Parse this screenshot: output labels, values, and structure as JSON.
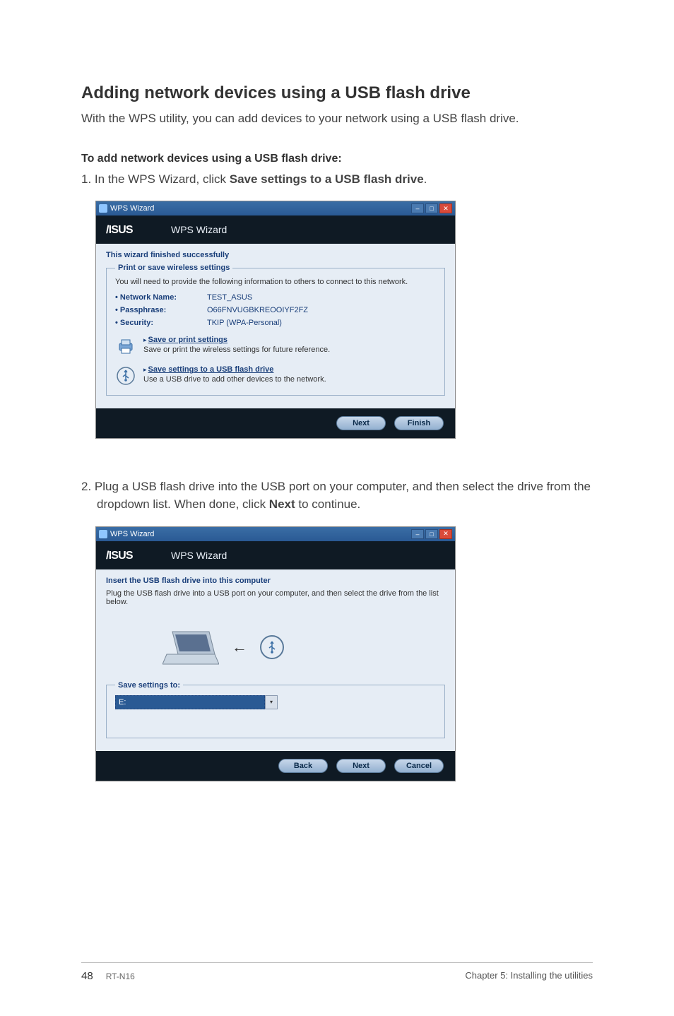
{
  "page": {
    "title": "Adding network devices using a USB flash drive",
    "intro": "With the WPS utility, you can add devices to your network using a USB flash drive.",
    "subhead": "To add network devices using a USB flash drive:",
    "step1_prefix": "1. In the WPS Wizard, click ",
    "step1_bold": "Save settings to a USB flash drive",
    "step1_suffix": ".",
    "step2_prefix": "2.  Plug a USB flash drive into the USB port on your computer, and then select the drive from the dropdown list. When done, click ",
    "step2_bold": "Next",
    "step2_suffix": " to continue."
  },
  "shot1": {
    "titlebar": "WPS Wizard",
    "brand": "WPS Wizard",
    "heading": "This wizard finished successfully",
    "group_legend": "Print or save wireless settings",
    "hint": "You will need to provide the following information to others to connect to this network.",
    "rows": [
      {
        "label": "• Network Name:",
        "value": "TEST_ASUS"
      },
      {
        "label": "• Passphrase:",
        "value": "O66FNVUGBKREOOIYF2FZ"
      },
      {
        "label": "• Security:",
        "value": "TKIP (WPA-Personal)"
      }
    ],
    "action1_link": "Save or print settings",
    "action1_desc": "Save or print the wireless settings for future reference.",
    "action2_link": "Save settings to a USB flash drive",
    "action2_desc": "Use a USB drive to add other devices to the network.",
    "btn_next": "Next",
    "btn_finish": "Finish"
  },
  "shot2": {
    "titlebar": "WPS Wizard",
    "brand": "WPS Wizard",
    "heading": "Insert the USB flash drive into this computer",
    "hint": "Plug the USB flash drive into a USB port on your computer, and then select the drive from the list below.",
    "group_legend": "Save settings to:",
    "selected_drive": "E:",
    "btn_back": "Back",
    "btn_next": "Next",
    "btn_cancel": "Cancel"
  },
  "footer": {
    "page_number": "48",
    "model": "RT-N16",
    "chapter": "Chapter 5: Installing the utilities"
  },
  "icons": {
    "minimize": "–",
    "maximize": "□",
    "close": "✕",
    "caret_right": "▸",
    "arrow_left": "←",
    "dropdown": "▾"
  }
}
